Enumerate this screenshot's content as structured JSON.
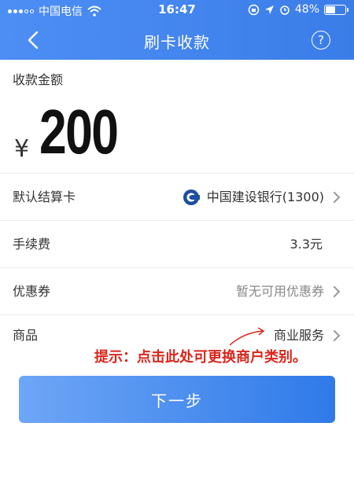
{
  "status_bar": {
    "carrier": "中国电信",
    "time": "16:47",
    "battery": "48%",
    "battery_level": 0.48
  },
  "nav": {
    "title": "刷卡收款",
    "help_label": "?"
  },
  "amount": {
    "label": "收款金额",
    "currency": "¥",
    "value": "200"
  },
  "rows": {
    "settlement_card": {
      "label": "默认结算卡",
      "value": "中国建设银行(1300)"
    },
    "fee": {
      "label": "手续费",
      "value": "3.3元"
    },
    "coupon": {
      "label": "优惠券",
      "value": "暂无可用优惠券"
    },
    "goods": {
      "label": "商品",
      "value": "商业服务"
    }
  },
  "hint": "提示：点击此处可更换商户类别。",
  "next_button": "下一步",
  "colors": {
    "header": "#3b7de8",
    "hint": "#d9261c",
    "button": "#2f7ae9"
  }
}
